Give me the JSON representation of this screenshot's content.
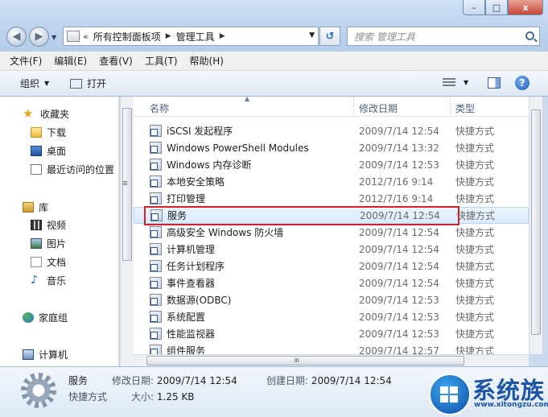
{
  "window": {
    "minimize": "–",
    "maximize": "□",
    "close": "x"
  },
  "address": {
    "chevron": "«",
    "crumbs": [
      "所有控制面板项",
      "管理工具"
    ],
    "separator": "▶"
  },
  "search": {
    "placeholder": "搜索 管理工具"
  },
  "menu": [
    "文件(F)",
    "编辑(E)",
    "查看(V)",
    "工具(T)",
    "帮助(H)"
  ],
  "toolbar": {
    "organize": "组织",
    "open": "打开"
  },
  "nav": {
    "favorites": "收藏夹",
    "downloads": "下载",
    "desktop": "桌面",
    "recent": "最近访问的位置",
    "libraries": "库",
    "videos": "视频",
    "pictures": "图片",
    "documents": "文档",
    "music": "音乐",
    "homegroup": "家庭组",
    "computer": "计算机"
  },
  "columns": {
    "name": "名称",
    "date": "修改日期",
    "type": "类型"
  },
  "files": [
    {
      "name": "iSCSI 发起程序",
      "date": "2009/7/14 12:54",
      "type": "快捷方式"
    },
    {
      "name": "Windows PowerShell Modules",
      "date": "2009/7/14 13:32",
      "type": "快捷方式"
    },
    {
      "name": "Windows 内存诊断",
      "date": "2009/7/14 12:53",
      "type": "快捷方式"
    },
    {
      "name": "本地安全策略",
      "date": "2012/7/16 9:14",
      "type": "快捷方式"
    },
    {
      "name": "打印管理",
      "date": "2012/7/16 9:14",
      "type": "快捷方式"
    },
    {
      "name": "服务",
      "date": "2009/7/14 12:54",
      "type": "快捷方式",
      "selected": true
    },
    {
      "name": "高级安全 Windows 防火墙",
      "date": "2009/7/14 12:54",
      "type": "快捷方式"
    },
    {
      "name": "计算机管理",
      "date": "2009/7/14 12:54",
      "type": "快捷方式"
    },
    {
      "name": "任务计划程序",
      "date": "2009/7/14 12:54",
      "type": "快捷方式"
    },
    {
      "name": "事件查看器",
      "date": "2009/7/14 12:54",
      "type": "快捷方式"
    },
    {
      "name": "数据源(ODBC)",
      "date": "2009/7/14 12:53",
      "type": "快捷方式"
    },
    {
      "name": "系统配置",
      "date": "2009/7/14 12:53",
      "type": "快捷方式"
    },
    {
      "name": "性能监视器",
      "date": "2009/7/14 12:53",
      "type": "快捷方式"
    },
    {
      "name": "组件服务",
      "date": "2009/7/14 12:57",
      "type": "快捷方式"
    }
  ],
  "details": {
    "name": "服务",
    "type": "快捷方式",
    "modified_label": "修改日期:",
    "modified_value": "2009/7/14 12:54",
    "created_label": "创建日期:",
    "created_value": "2009/7/14 12:54",
    "size_label": "大小:",
    "size_value": "1.25 KB"
  },
  "watermark": {
    "title": "系统族",
    "url": "www.xitongzu.com"
  },
  "colors": {
    "highlight_border": "#d2232a",
    "selection_bg": "#dbeafc",
    "accent": "#1c56a5"
  }
}
